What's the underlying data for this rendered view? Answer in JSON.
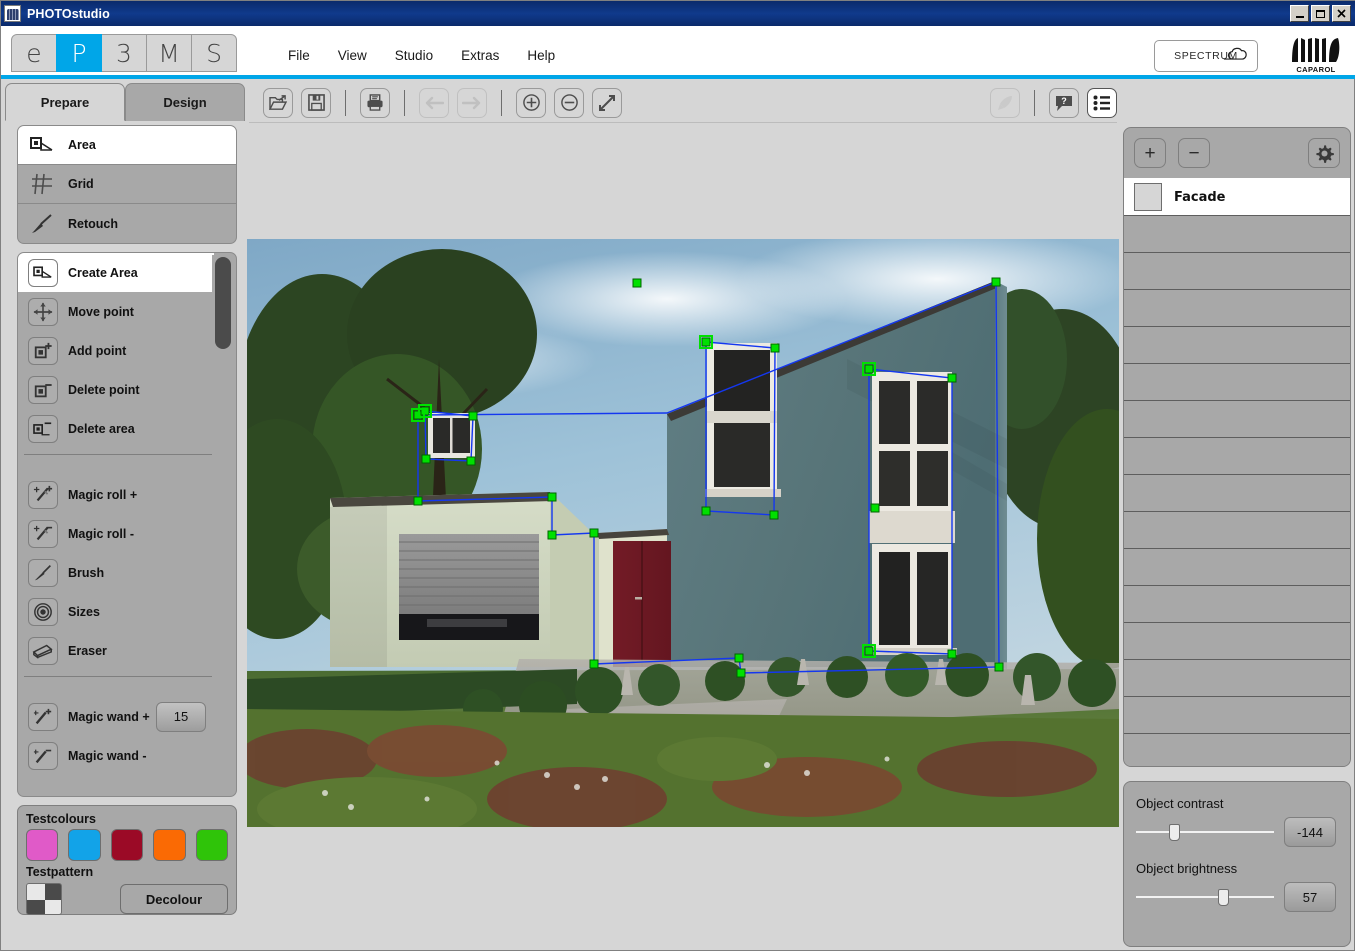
{
  "window": {
    "title": "PHOTOstudio",
    "minimize_label": "_",
    "maximize_label": "",
    "close_label": "✕"
  },
  "mode_tabs": [
    {
      "label": "e",
      "active": false
    },
    {
      "label": "P",
      "active": true
    },
    {
      "label": "3",
      "active": false
    },
    {
      "label": "M",
      "active": false
    },
    {
      "label": "S",
      "active": false
    }
  ],
  "menu": [
    "File",
    "View",
    "Studio",
    "Extras",
    "Help"
  ],
  "brand": {
    "spectrum_label": "SPECTRUM",
    "caparol_label": "CAPAROL",
    "accent_color": "#00a6e8"
  },
  "left_panel": {
    "tabs": [
      {
        "label": "Prepare",
        "active": true
      },
      {
        "label": "Design",
        "active": false
      }
    ],
    "mode_tools": [
      {
        "label": "Area",
        "icon": "area-icon",
        "selected": true
      },
      {
        "label": "Grid",
        "icon": "grid-icon",
        "selected": false
      },
      {
        "label": "Retouch",
        "icon": "brush-icon",
        "selected": false
      }
    ],
    "tools": [
      {
        "label": "Create Area",
        "icon": "create-area-icon",
        "selected": true
      },
      {
        "label": "Move point",
        "icon": "move-point-icon",
        "selected": false
      },
      {
        "label": "Add point",
        "icon": "add-point-icon",
        "selected": false
      },
      {
        "label": "Delete point",
        "icon": "delete-point-icon",
        "selected": false
      },
      {
        "label": "Delete area",
        "icon": "delete-area-icon",
        "selected": false
      }
    ],
    "tools2": [
      {
        "label": "Magic roll +",
        "icon": "magic-roll-plus-icon"
      },
      {
        "label": "Magic roll -",
        "icon": "magic-roll-minus-icon"
      },
      {
        "label": "Brush",
        "icon": "brush-icon"
      },
      {
        "label": "Sizes",
        "icon": "sizes-icon"
      },
      {
        "label": "Eraser",
        "icon": "eraser-icon"
      }
    ],
    "wand_tools": [
      {
        "label": "Magic wand +",
        "icon": "magic-wand-plus-icon",
        "value": "15"
      },
      {
        "label": "Magic wand  -",
        "icon": "magic-wand-minus-icon",
        "value": ""
      }
    ],
    "testcolours": {
      "title": "Testcolours",
      "swatches": [
        "#e05ac8",
        "#12a3e8",
        "#9b0a26",
        "#fa6a04",
        "#2fc409"
      ],
      "pattern_title": "Testpattern",
      "decolour_label": "Decolour"
    }
  },
  "toolbar": {
    "buttons": [
      {
        "name": "open-icon",
        "disabled": false,
        "white": false
      },
      {
        "name": "save-icon",
        "disabled": false,
        "white": false
      },
      {
        "divider": true
      },
      {
        "name": "print-icon",
        "disabled": false,
        "white": false
      },
      {
        "divider": true
      },
      {
        "name": "undo-arrow-icon",
        "disabled": true,
        "white": false
      },
      {
        "name": "redo-arrow-icon",
        "disabled": true,
        "white": false
      },
      {
        "divider": true
      },
      {
        "name": "zoom-in-icon",
        "disabled": false,
        "white": false
      },
      {
        "name": "zoom-out-icon",
        "disabled": false,
        "white": false
      },
      {
        "name": "fit-screen-icon",
        "disabled": false,
        "white": false
      }
    ],
    "right_buttons": [
      {
        "name": "rocket-icon",
        "disabled": true,
        "white": false
      },
      {
        "divider": true
      },
      {
        "name": "help-bubble-icon",
        "disabled": false,
        "white": false
      },
      {
        "name": "list-icon",
        "disabled": false,
        "white": true
      }
    ]
  },
  "right_panel": {
    "add_label": "+",
    "remove_label": "−",
    "gear_label": "gear-icon",
    "layers": [
      {
        "name": "Facade",
        "selected": true
      },
      {
        "name": "",
        "selected": false
      },
      {
        "name": "",
        "selected": false
      },
      {
        "name": "",
        "selected": false
      },
      {
        "name": "",
        "selected": false
      },
      {
        "name": "",
        "selected": false
      },
      {
        "name": "",
        "selected": false
      },
      {
        "name": "",
        "selected": false
      },
      {
        "name": "",
        "selected": false
      },
      {
        "name": "",
        "selected": false
      },
      {
        "name": "",
        "selected": false
      },
      {
        "name": "",
        "selected": false
      },
      {
        "name": "",
        "selected": false
      },
      {
        "name": "",
        "selected": false
      },
      {
        "name": "",
        "selected": false
      },
      {
        "name": "",
        "selected": false
      }
    ],
    "adjustments": [
      {
        "label": "Object contrast",
        "value": "-144",
        "knob_pct": 26
      },
      {
        "label": "Object brightness",
        "value": "57",
        "knob_pct": 63
      }
    ]
  },
  "image": {
    "description": "Architectural visualisation of a modern two-storey house with flat roof and attached garage",
    "facade_color": "#5a7a80",
    "garage_color": "#ccd4bd",
    "door_color": "#7a1d28",
    "sky_color": "#9fc0d6",
    "selection_stroke": "#1437f0",
    "handle_color": "#00d000"
  }
}
